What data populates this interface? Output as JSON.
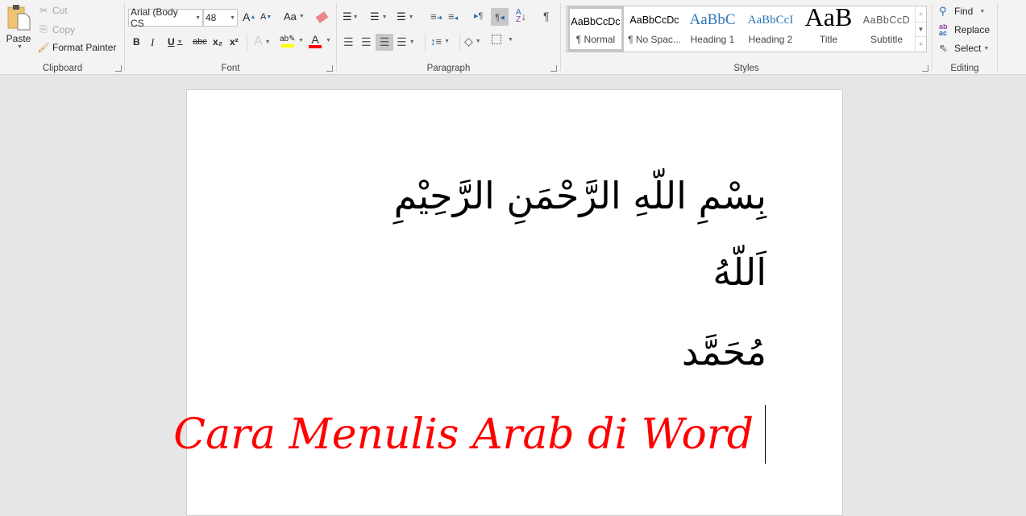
{
  "clipboard": {
    "label": "Clipboard",
    "paste": "Paste",
    "cut": "Cut",
    "copy": "Copy",
    "format_painter": "Format Painter"
  },
  "font": {
    "label": "Font",
    "font_name": "Arial (Body CS",
    "font_size": "48",
    "grow": "A",
    "shrink": "A",
    "change_case": "Aa",
    "bold": "B",
    "italic": "I",
    "underline": "U",
    "strike": "abc",
    "subscript": "x₂",
    "superscript": "x²",
    "text_effects": "A",
    "highlight_color": "#ffff00",
    "font_color": "#ff0000",
    "font_color_glyph": "A"
  },
  "paragraph": {
    "label": "Paragraph",
    "show_marks": "¶"
  },
  "styles": {
    "label": "Styles",
    "items": [
      {
        "preview": "AaBbCcDc",
        "name": "¶ Normal",
        "selected": true
      },
      {
        "preview": "AaBbCcDc",
        "name": "¶ No Spac..."
      },
      {
        "preview": "AaBbC",
        "name": "Heading 1"
      },
      {
        "preview": "AaBbCcI",
        "name": "Heading 2"
      },
      {
        "preview": "AaB",
        "name": "Title"
      },
      {
        "preview": "AaBbCcD",
        "name": "Subtitle"
      }
    ]
  },
  "editing": {
    "label": "Editing",
    "find": "Find",
    "replace": "Replace",
    "select": "Select"
  },
  "document": {
    "line1": "بِسْمِ اللّهِ الرَّحْمَنِ الرَّحِيْمِ",
    "line2": "اَللّهُ",
    "line3": "مُحَمَّد",
    "line4": "Cara Menulis Arab di Word",
    "line4_color": "#ff0000"
  }
}
